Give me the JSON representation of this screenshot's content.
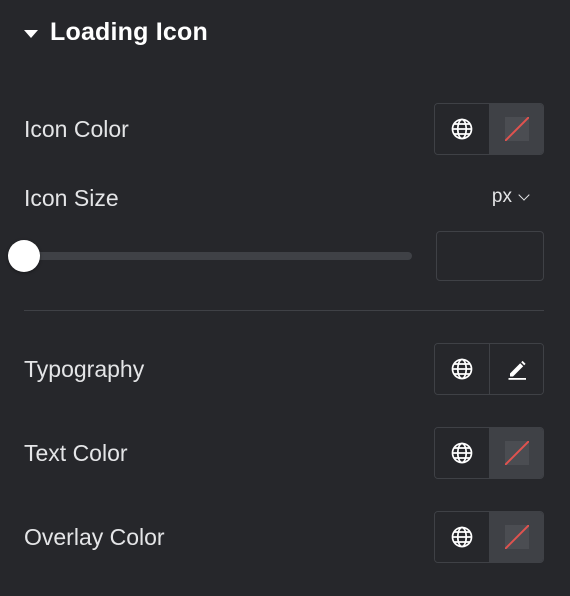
{
  "section": {
    "title": "Loading Icon"
  },
  "icon_color": {
    "label": "Icon Color"
  },
  "icon_size": {
    "label": "Icon Size",
    "unit": "px",
    "value": "",
    "slider_fraction": 0
  },
  "typography": {
    "label": "Typography"
  },
  "text_color": {
    "label": "Text Color"
  },
  "overlay_color": {
    "label": "Overlay Color"
  },
  "colors": {
    "panel_bg": "#26272b",
    "border": "#3f4146",
    "unset_slash": "#e0534f"
  },
  "icons": {
    "caret": "caret-down-icon",
    "global": "globe-icon",
    "edit": "pencil-icon",
    "unit_dropdown": "chevron-down-icon"
  }
}
